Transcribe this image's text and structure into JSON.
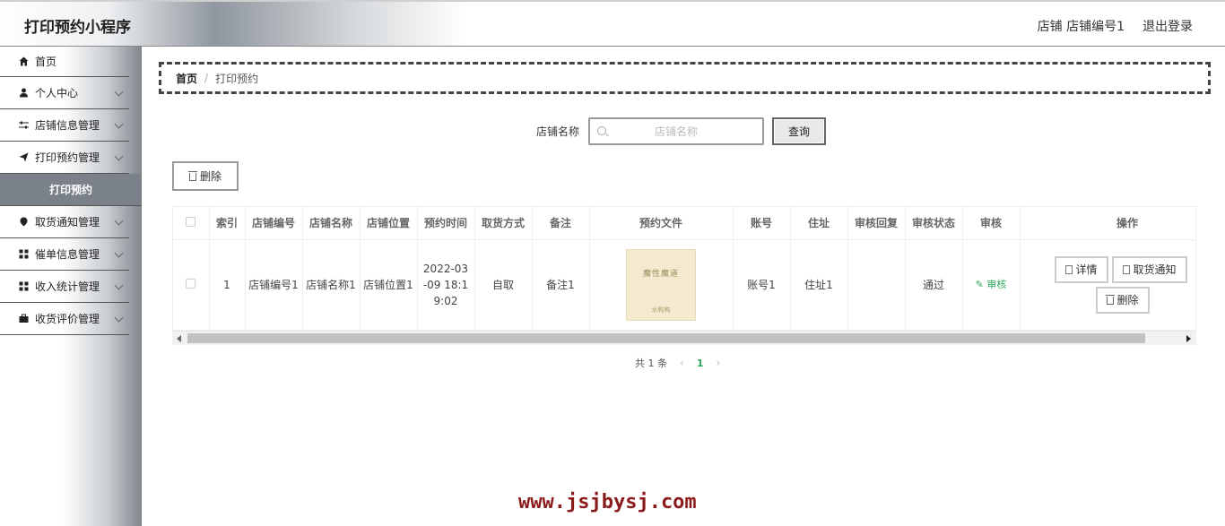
{
  "header": {
    "app_title": "打印预约小程序",
    "user_info": "店铺 店铺编号1",
    "logout": "退出登录"
  },
  "sidebar": {
    "items": [
      {
        "label": "首页",
        "icon": "home-icon",
        "has_children": false
      },
      {
        "label": "个人中心",
        "icon": "user-icon",
        "has_children": true
      },
      {
        "label": "店铺信息管理",
        "icon": "sliders-icon",
        "has_children": true
      },
      {
        "label": "打印预约管理",
        "icon": "send-icon",
        "has_children": true
      },
      {
        "label": "打印预约",
        "active_sub": true
      },
      {
        "label": "取货通知管理",
        "icon": "location-icon",
        "has_children": true
      },
      {
        "label": "催单信息管理",
        "icon": "grid-icon",
        "has_children": true
      },
      {
        "label": "收入统计管理",
        "icon": "grid-icon",
        "has_children": true
      },
      {
        "label": "收货评价管理",
        "icon": "briefcase-icon",
        "has_children": true
      }
    ]
  },
  "breadcrumb": {
    "home": "首页",
    "separator": "/",
    "current": "打印预约"
  },
  "search": {
    "label": "店铺名称",
    "placeholder": "店铺名称",
    "button": "查询"
  },
  "actions": {
    "delete": "删除"
  },
  "table": {
    "columns": [
      "",
      "索引",
      "店铺编号",
      "店铺名称",
      "店铺位置",
      "预约时间",
      "取货方式",
      "备注",
      "预约文件",
      "账号",
      "住址",
      "审核回复",
      "审核状态",
      "审核",
      "操作"
    ],
    "rows": [
      {
        "index": "1",
        "shop_no": "店铺编号1",
        "shop_name": "店铺名称1",
        "shop_location": "店铺位置1",
        "time": "2022-03-09 18:19:02",
        "pickup": "自取",
        "note": "备注1",
        "file_title": "魔性魔道",
        "file_author": "水鸭鸭",
        "account": "账号1",
        "address": "住址1",
        "reply": "",
        "status": "通过",
        "audit": "审核",
        "ops": {
          "detail": "详情",
          "notify": "取货通知",
          "delete": "删除"
        }
      }
    ]
  },
  "pagination": {
    "total": "共 1 条",
    "current_page": "1",
    "prev": "‹",
    "next": "›"
  },
  "watermark": "www.jsjbysj.com",
  "colors": {
    "accent_green": "#2eaa5a",
    "sidebar_active": "#7b8189",
    "watermark": "#8b1a1a"
  }
}
